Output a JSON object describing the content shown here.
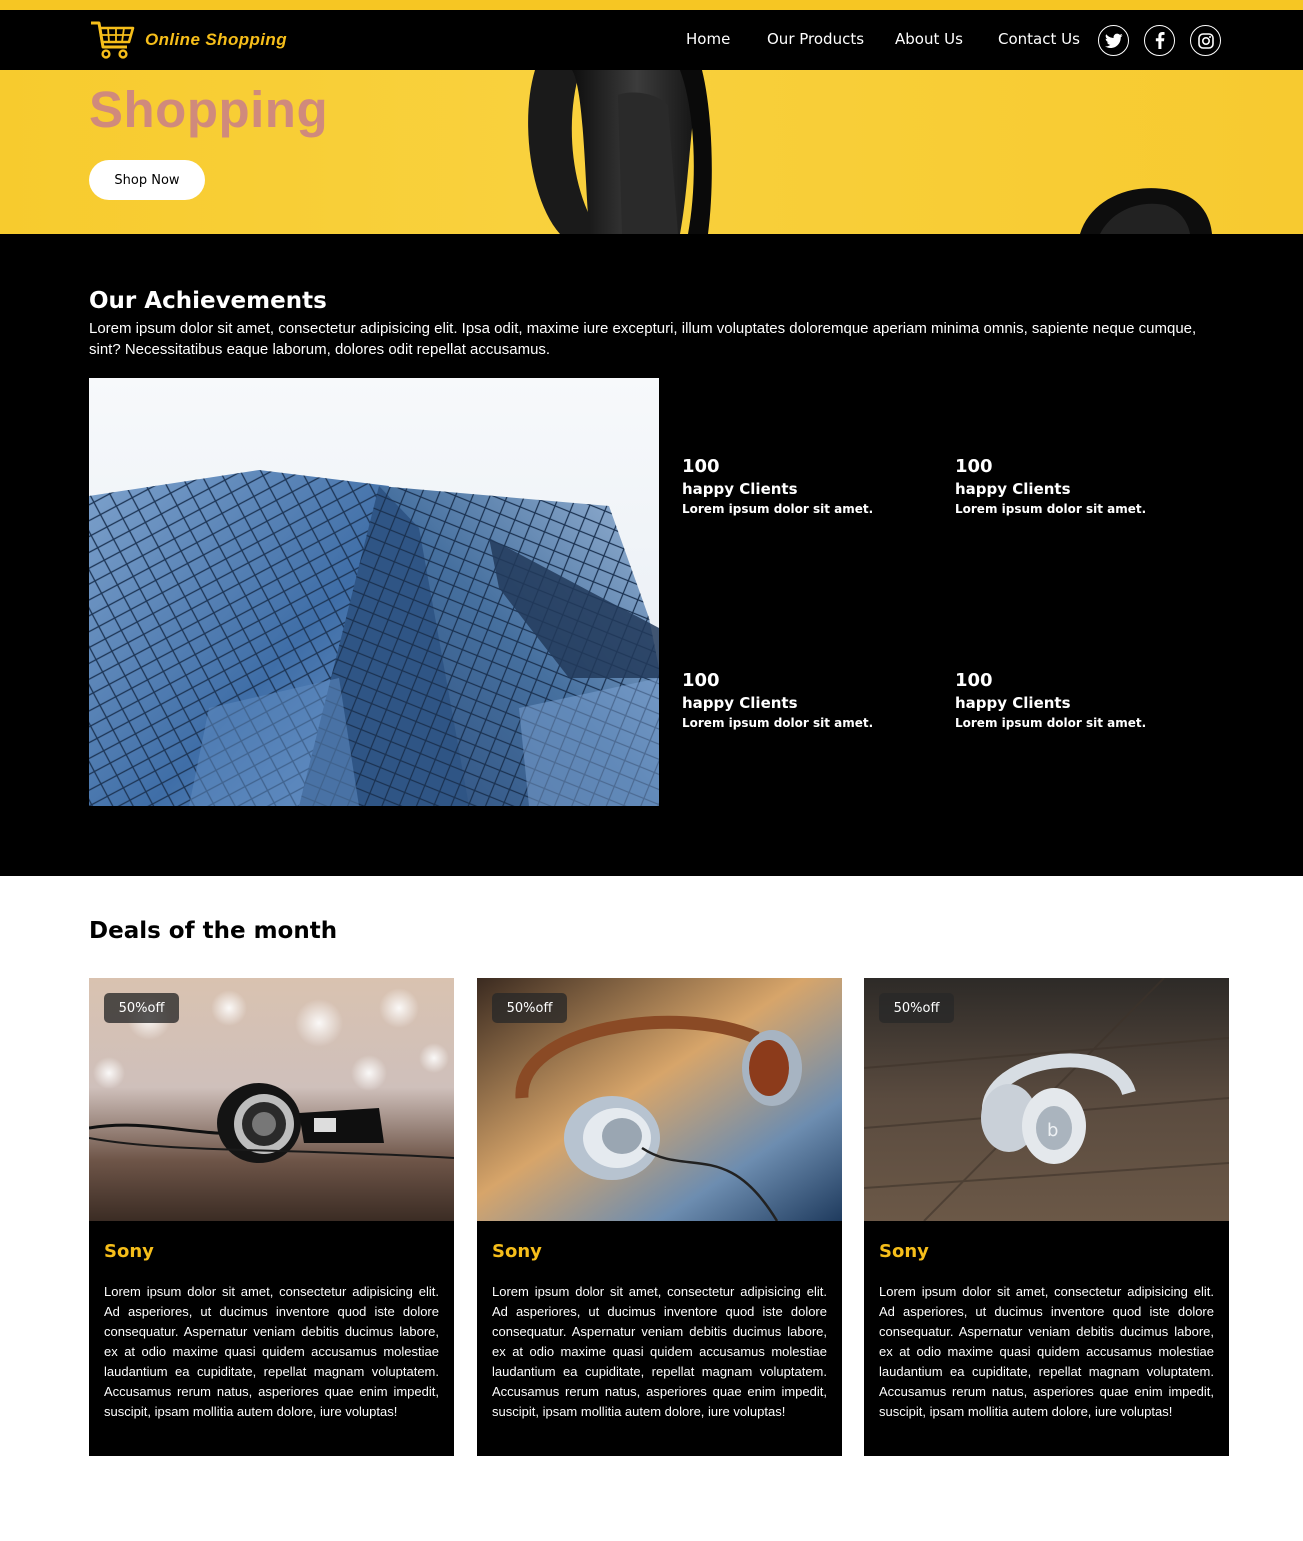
{
  "nav": {
    "logo_text": "Online Shopping",
    "links": [
      "Home",
      "Our Products",
      "About Us",
      "Contact Us"
    ],
    "social_icons": [
      "twitter-icon",
      "facebook-icon",
      "instagram-icon"
    ]
  },
  "hero": {
    "title": "Shopping",
    "button_label": "Shop Now"
  },
  "achievements": {
    "title": "Our Achievements",
    "intro": "Lorem ipsum dolor sit amet, consectetur adipisicing elit. Ipsa odit, maxime iure excepturi, illum voluptates doloremque aperiam minima omnis, sapiente neque cumque, sint? Necessitatibus eaque laborum, dolores odit repellat accusamus.",
    "stats": [
      {
        "number": "100",
        "label": "happy Clients",
        "desc": "Lorem ipsum dolor sit amet."
      },
      {
        "number": "100",
        "label": "happy Clients",
        "desc": "Lorem ipsum dolor sit amet."
      },
      {
        "number": "100",
        "label": "happy Clients",
        "desc": "Lorem ipsum dolor sit amet."
      },
      {
        "number": "100",
        "label": "happy Clients",
        "desc": "Lorem ipsum dolor sit amet."
      }
    ]
  },
  "deals": {
    "title": "Deals of the month",
    "cards": [
      {
        "badge": "50%off",
        "name": "Sony",
        "text": "Lorem ipsum dolor sit amet, consectetur adipisicing elit. Ad asperiores, ut ducimus inventore quod iste dolore consequatur. Aspernatur veniam debitis ducimus labore, ex at odio maxime quasi quidem accusamus molestiae laudantium ea cupiditate, repellat magnam voluptatem. Accusamus rerum natus, asperiores quae enim impedit, suscipit, ipsam mollitia autem dolore, iure voluptas!"
      },
      {
        "badge": "50%off",
        "name": "Sony",
        "text": "Lorem ipsum dolor sit amet, consectetur adipisicing elit. Ad asperiores, ut ducimus inventore quod iste dolore consequatur. Aspernatur veniam debitis ducimus labore, ex at odio maxime quasi quidem accusamus molestiae laudantium ea cupiditate, repellat magnam voluptatem. Accusamus rerum natus, asperiores quae enim impedit, suscipit, ipsam mollitia autem dolore, iure voluptas!"
      },
      {
        "badge": "50%off",
        "name": "Sony",
        "text": "Lorem ipsum dolor sit amet, consectetur adipisicing elit. Ad asperiores, ut ducimus inventore quod iste dolore consequatur. Aspernatur veniam debitis ducimus labore, ex at odio maxime quasi quidem accusamus molestiae laudantium ea cupiditate, repellat magnam voluptatem. Accusamus rerum natus, asperiores quae enim impedit, suscipit, ipsam mollitia autem dolore, iure voluptas!"
      }
    ]
  },
  "colors": {
    "accent": "#f6be1a",
    "hero_background": "#f9d13d",
    "hero_title": "#d08a7c",
    "dark": "#000000"
  }
}
